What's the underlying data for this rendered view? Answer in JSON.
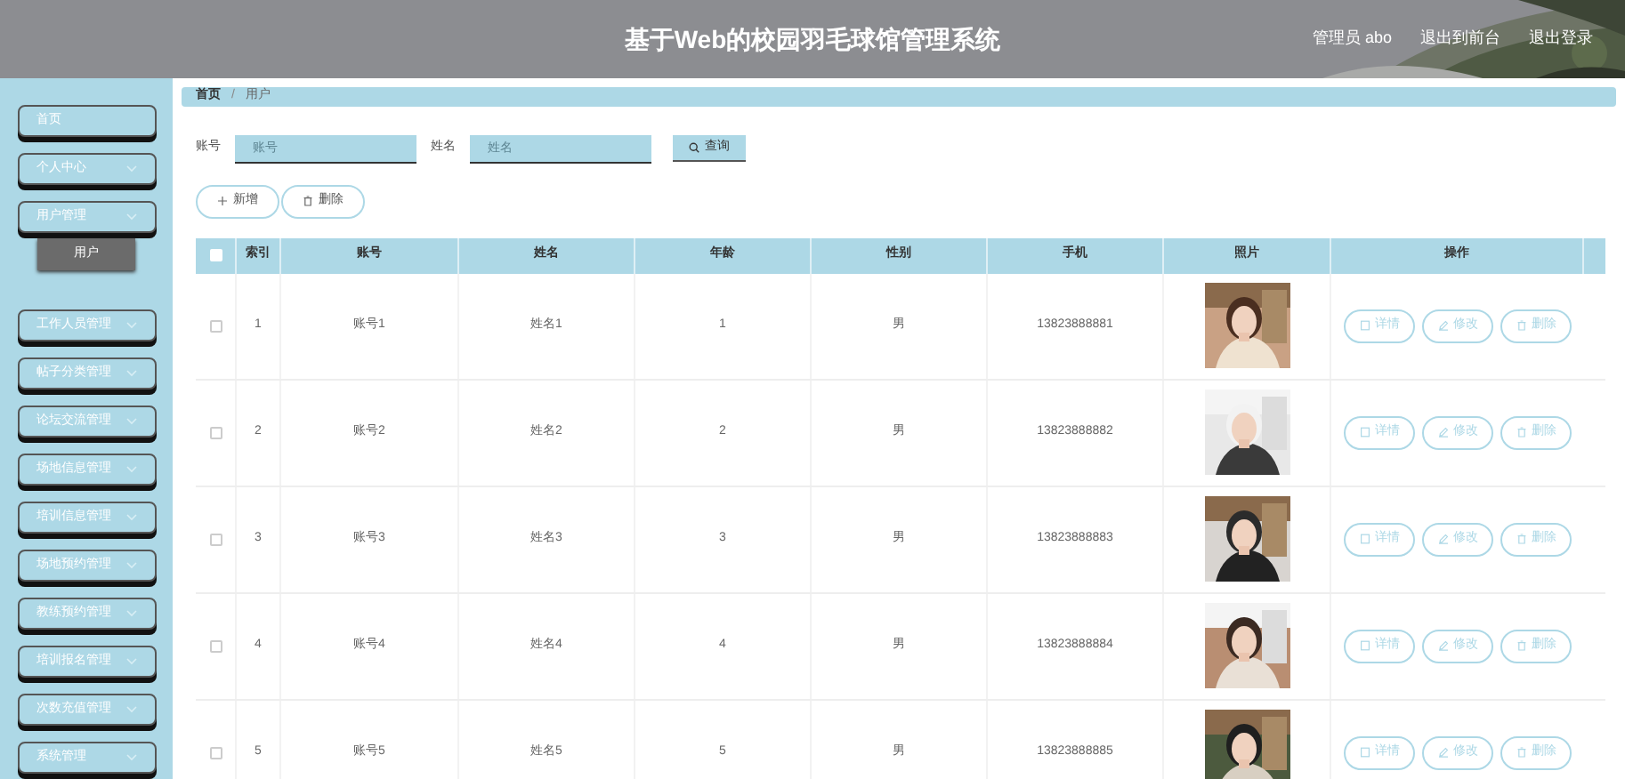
{
  "header": {
    "title": "基于Web的校园羽毛球馆管理系统",
    "links": [
      "管理员 abo",
      "退出到前台",
      "退出登录"
    ]
  },
  "sidebar": {
    "items": [
      {
        "label": "首页",
        "kind": "link"
      },
      {
        "label": "个人中心",
        "kind": "menu"
      },
      {
        "label": "用户管理",
        "kind": "menu",
        "children": [
          {
            "label": "用户",
            "selected": true
          }
        ]
      },
      {
        "label": "工作人员管理",
        "kind": "menu"
      },
      {
        "label": "帖子分类管理",
        "kind": "menu"
      },
      {
        "label": "论坛交流管理",
        "kind": "menu"
      },
      {
        "label": "场地信息管理",
        "kind": "menu"
      },
      {
        "label": "培训信息管理",
        "kind": "menu"
      },
      {
        "label": "场地预约管理",
        "kind": "menu"
      },
      {
        "label": "教练预约管理",
        "kind": "menu"
      },
      {
        "label": "培训报名管理",
        "kind": "menu"
      },
      {
        "label": "次数充值管理",
        "kind": "menu"
      },
      {
        "label": "系统管理",
        "kind": "menu"
      }
    ]
  },
  "breadcrumb": {
    "items": [
      "首页",
      "用户"
    ],
    "separator": "/"
  },
  "search": {
    "fields": [
      {
        "label": "账号",
        "placeholder": "账号"
      },
      {
        "label": "姓名",
        "placeholder": "姓名"
      }
    ],
    "button": "查询"
  },
  "actions": [
    "新增",
    "删除"
  ],
  "table": {
    "select_all": {
      "checked": false
    },
    "columns": [
      "索引",
      "账号",
      "姓名",
      "年龄",
      "性别",
      "手机",
      "照片",
      "操作"
    ],
    "rows": [
      {
        "checked": false,
        "cells": [
          "1",
          "账号1",
          "姓名1",
          "1",
          "男",
          "13823888881"
        ],
        "buttons": [
          "详情",
          "修改",
          "删除"
        ]
      },
      {
        "checked": false,
        "cells": [
          "2",
          "账号2",
          "姓名2",
          "2",
          "男",
          "13823888882"
        ],
        "buttons": [
          "详情",
          "修改",
          "删除"
        ]
      },
      {
        "checked": false,
        "cells": [
          "3",
          "账号3",
          "姓名3",
          "3",
          "男",
          "13823888883"
        ],
        "buttons": [
          "详情",
          "修改",
          "删除"
        ]
      },
      {
        "checked": false,
        "cells": [
          "4",
          "账号4",
          "姓名4",
          "4",
          "男",
          "13823888884"
        ],
        "buttons": [
          "详情",
          "修改",
          "删除"
        ]
      },
      {
        "checked": false,
        "cells": [
          "5",
          "账号5",
          "姓名5",
          "5",
          "男",
          "13823888885"
        ],
        "buttons": [
          "详情",
          "修改",
          "删除"
        ]
      }
    ]
  }
}
